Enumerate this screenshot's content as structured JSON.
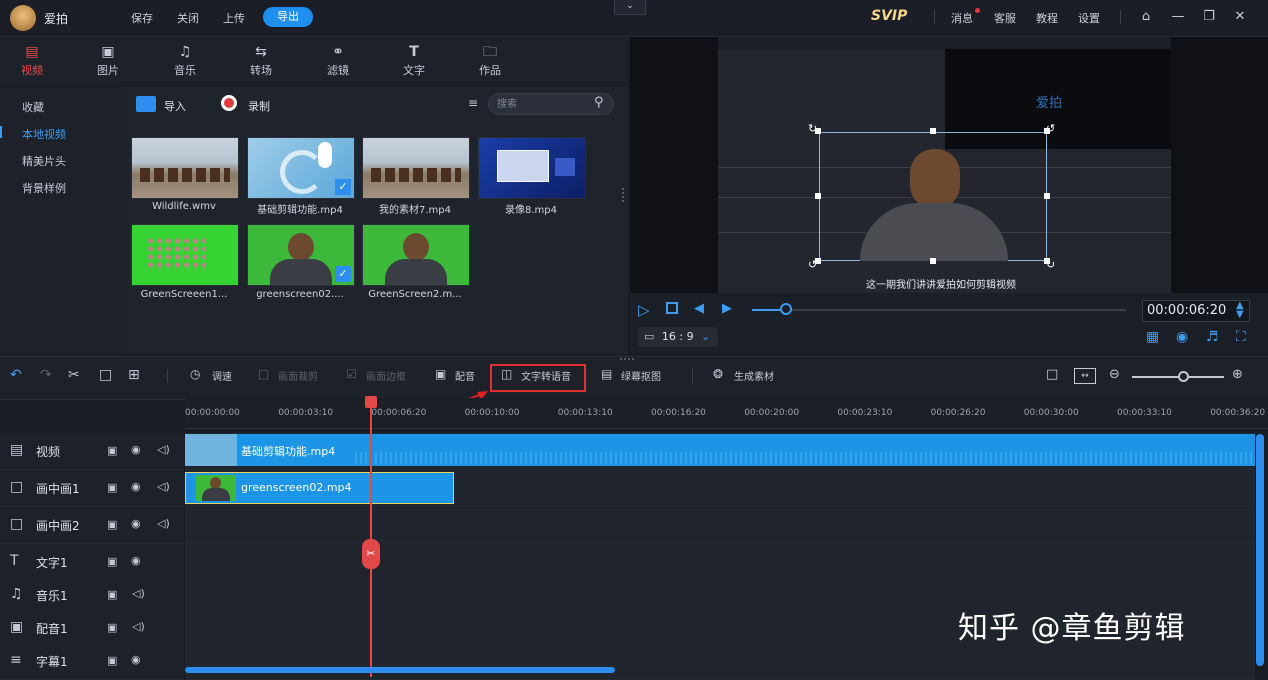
{
  "titlebar": {
    "app_name": "爱拍",
    "menu": [
      "保存",
      "关闭",
      "上传"
    ],
    "export_label": "导出",
    "svip": "SVIP",
    "links": [
      "消息",
      "客服",
      "教程",
      "设置"
    ]
  },
  "media_tabs": [
    "视频",
    "图片",
    "音乐",
    "转场",
    "滤镜",
    "文字",
    "作品"
  ],
  "left_nav": [
    "收藏",
    "本地视频",
    "精美片头",
    "背景样例"
  ],
  "library": {
    "import_label": "导入",
    "record_label": "录制",
    "search_placeholder": "搜索",
    "items": [
      "Wildlife.wmv",
      "基础剪辑功能.mp4",
      "我的素材7.mp4",
      "录像8.mp4",
      "GreenScreeen1...",
      "greenscreen02....",
      "GreenScreen2.m..."
    ]
  },
  "preview": {
    "subtitle": "这一期我们讲讲爱拍如何剪辑视频",
    "logo_text": "爱拍",
    "timecode": "00:00:06:20",
    "aspect_ratio": "16 : 9"
  },
  "toolbar": {
    "speed": "调速",
    "crop": "画面裁剪",
    "border": "画面边框",
    "dub": "配音",
    "tts": "文字转语音",
    "screen_matting": "绿幕抠图",
    "generate": "生成素材"
  },
  "ruler_ticks": [
    "00:00:00:00",
    "00:00:03:10",
    "00:00:06:20",
    "00:00:10:00",
    "00:00:13:10",
    "00:00:16:20",
    "00:00:20:00",
    "00:00:23:10",
    "00:00:26:20",
    "00:00:30:00",
    "00:00:33:10",
    "00:00:36:20"
  ],
  "tracks": [
    "视频",
    "画中画1",
    "画中画2",
    "文字1",
    "音乐1",
    "配音1",
    "字幕1"
  ],
  "clips": {
    "video": "基础剪辑功能.mp4",
    "pip": "greenscreen02.mp4"
  },
  "watermark": "知乎 @章鱼剪辑",
  "colors": {
    "accent": "#1f8ff0",
    "highlight": "#e03030",
    "playhead": "#e24848",
    "clip": "#1c95e6"
  }
}
